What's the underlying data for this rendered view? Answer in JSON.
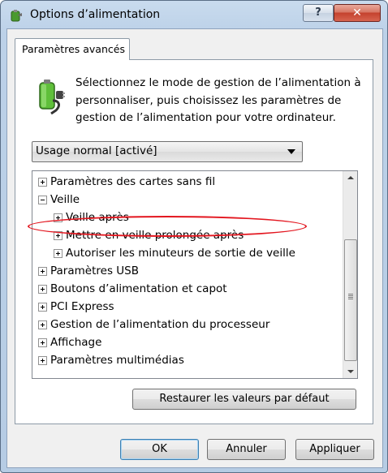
{
  "window": {
    "title": "Options d’alimentation",
    "help_label": "?",
    "close_label": "✕"
  },
  "tab": {
    "label": "Paramètres avancés"
  },
  "description": "Sélectionnez le mode de gestion de l’alimentation à personnaliser, puis choisissez les paramètres de gestion de l’alimentation pour votre ordinateur.",
  "plan_select": {
    "value": "Usage normal [activé]"
  },
  "tree": {
    "items": [
      {
        "label": "Paramètres des cartes sans fil",
        "expanded": false
      },
      {
        "label": "Veille",
        "expanded": true
      },
      {
        "label": "Veille après",
        "expanded": false
      },
      {
        "label": "Mettre en veille prolongée après",
        "expanded": false
      },
      {
        "label": "Autoriser les minuteurs de sortie de veille",
        "expanded": false,
        "highlighted": true
      },
      {
        "label": "Paramètres USB",
        "expanded": false
      },
      {
        "label": "Boutons d’alimentation et capot",
        "expanded": false
      },
      {
        "label": "PCI Express",
        "expanded": false
      },
      {
        "label": "Gestion de l’alimentation du processeur",
        "expanded": false
      },
      {
        "label": "Affichage",
        "expanded": false
      },
      {
        "label": "Paramètres multimédias",
        "expanded": false
      }
    ]
  },
  "buttons": {
    "restore": "Restaurer les valeurs par défaut",
    "ok": "OK",
    "cancel": "Annuler",
    "apply": "Appliquer"
  },
  "colors": {
    "highlight_ellipse": "#e3161f",
    "battery_green": "#5fbf3a"
  }
}
